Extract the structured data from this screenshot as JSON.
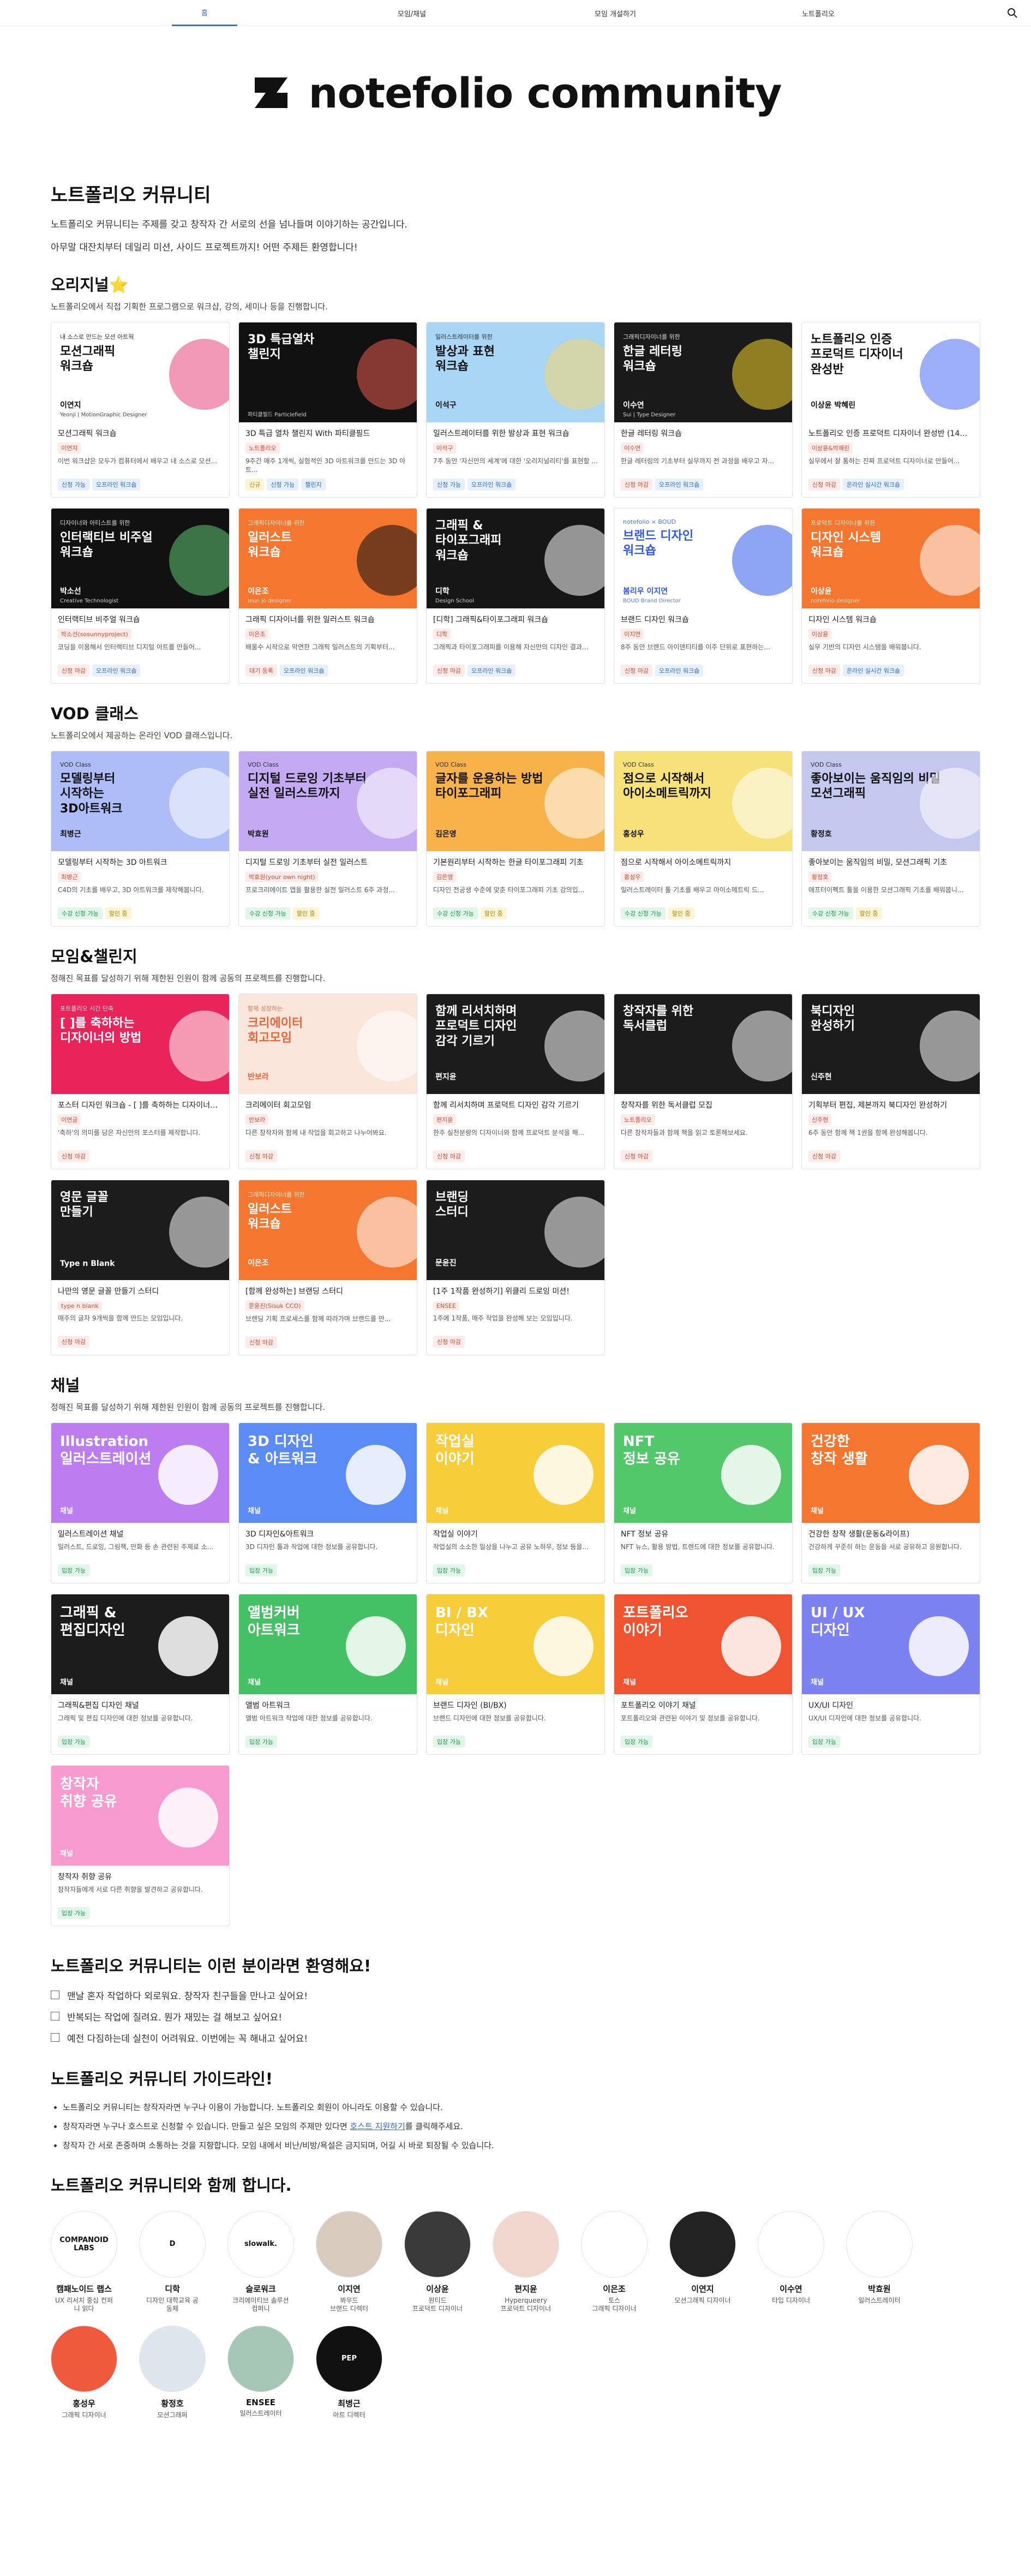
{
  "nav": {
    "tabs": [
      "홈",
      "모임/채널",
      "모임 개설하기",
      "노트폴리오"
    ],
    "active": 0
  },
  "hero": {
    "logo_text": "notefolio community"
  },
  "intro": {
    "title": "노트폴리오 커뮤니티",
    "line1": "노트폴리오 커뮤니티는 주제를 갖고 창작자 간 서로의 선을 넘나들며 이야기하는 공간입니다.",
    "line2": "아무말 대잔치부터 데일리 미션, 사이드 프로젝트까지! 어떤 주제든 환영합니다!"
  },
  "original": {
    "title": "오리지널⭐",
    "desc": "노트폴리오에서 직접 기획한 프로그램으로 워크샵, 강의, 세미나 등을 진행합니다.",
    "cards": [
      {
        "kicker": "내 소스로 만드는 모션 아트웍",
        "ttl": "모션그래픽\n워크숍",
        "auth": "이연지",
        "role": "Yeonji | MotionGraphic Designer",
        "title": "모션그래픽 워크숍",
        "tag": "이연지",
        "desc": "이번 워크샵은 모두가 컴퓨터에서 배우고 내 소스로 모션...",
        "chips": [
          [
            "신청 가능",
            "blue"
          ],
          [
            "오프라인 워크숍",
            "blue"
          ]
        ],
        "bg": "#ffffff",
        "fg": "#111",
        "accent": "#e8467c"
      },
      {
        "kicker": "",
        "ttl": "3D 특급열차\n챌린지",
        "auth": "",
        "role": "파티클필드 Particlefield",
        "title": "3D 특급 열차 챌린지 With 파티클필드",
        "tag": "노트폴리오",
        "desc": "9주간 매주 1개씩, 실험적인 3D 아트워크를 만드는 3D 아트...",
        "chips": [
          [
            "신규",
            "yellow"
          ],
          [
            "신청 가능",
            "blue"
          ],
          [
            "챌린지",
            "blue"
          ]
        ],
        "bg": "#111111",
        "fg": "#fff",
        "accent": "#e85a4f"
      },
      {
        "kicker": "일러스트레이터를 위한",
        "ttl": "발상과 표현\n워크숍",
        "auth": "이석구",
        "role": "",
        "title": "일러스트레이터를 위한 발상과 표현 워크숍",
        "tag": "이석구",
        "desc": "7주 동안 '자신만의 세계'에 대한 '오리지널리티'를 표현할 ...",
        "chips": [
          [
            "신청 가능",
            "blue"
          ],
          [
            "오프라인 워크숍",
            "blue"
          ]
        ],
        "bg": "#a9d6f5",
        "fg": "#111",
        "accent": "#f5d66b"
      },
      {
        "kicker": "그래픽디자이너를 위한",
        "ttl": "한글 레터링\n워크숍",
        "auth": "이수연",
        "role": "Sui | Type Designer",
        "title": "한글 레터링 워크숍",
        "tag": "이수연",
        "desc": "한글 레터링의 기초부터 실무까지 전 과정을 배우고 자...",
        "chips": [
          [
            "신청 마감",
            "red"
          ],
          [
            "오프라인 워크숍",
            "blue"
          ]
        ],
        "bg": "#1a1a1a",
        "fg": "#fff",
        "accent": "#f2d42a"
      },
      {
        "kicker": "",
        "ttl": "노트폴리오 인증\n프로덕트 디자이너\n완성반",
        "auth": "이상윤 박혜린",
        "role": "",
        "title": "노트폴리오 인증 프로덕트 디자이너 완성반 (14주코스)",
        "tag": "이상윤&박혜린",
        "desc": "실무에서 잘 통하는 진짜 프로덕트 디자이너로 만들어...",
        "chips": [
          [
            "신청 마감",
            "red"
          ],
          [
            "온라인 실시간 워크숍",
            "blue"
          ]
        ],
        "bg": "#ffffff",
        "fg": "#111",
        "accent": "#4b6cf0"
      },
      {
        "kicker": "디자이너와 아티스트를 위한",
        "ttl": "인터랙티브 비주얼\n워크숍",
        "auth": "박소선",
        "role": "Creative Technologist",
        "title": "인터랙티브 비주얼 워크숍",
        "tag": "박소선(sosunnyproject)",
        "desc": "코딩을 이용해서 인터랙티브 디지털 아트를 만들어...",
        "chips": [
          [
            "신청 마감",
            "red"
          ],
          [
            "오프라인 워크숍",
            "blue"
          ]
        ],
        "bg": "#111111",
        "fg": "#fff",
        "accent": "#5ec46f"
      },
      {
        "kicker": "그래픽디자이너를 위한",
        "ttl": "일러스트\n워크숍",
        "auth": "이은조",
        "role": "Ieun Jo designer",
        "title": "그래픽 디자이너를 위한 일러스트 워크숍",
        "tag": "이은조",
        "desc": "배울수 시작으로 막연한 그래픽 일러스트의 기획부터...",
        "chips": [
          [
            "대기 등록",
            "red"
          ],
          [
            "오프라인 워크숍",
            "blue"
          ]
        ],
        "bg": "#f4762f",
        "fg": "#fff",
        "accent": "#111"
      },
      {
        "kicker": "",
        "ttl": "그래픽 &\n타이포그래피\n워크숍",
        "auth": "디학",
        "role": "Design School",
        "title": "[디학] 그래픽&타이포그래피 워크숍",
        "tag": "디학",
        "desc": "그래픽과 타이포그래피를 이용해 자신만의 디자인 결과...",
        "chips": [
          [
            "신청 마감",
            "red"
          ],
          [
            "오프라인 워크숍",
            "blue"
          ]
        ],
        "bg": "#161616",
        "fg": "#fff",
        "accent": "#fff"
      },
      {
        "kicker": "notefolio × BOUD",
        "ttl": "브랜드 디자인\n워크숍",
        "auth": "봄리우 이지연",
        "role": "BOUD Brand Director",
        "title": "브랜드 디자인 워크숍",
        "tag": "이지연",
        "desc": "8주 동안 브랜드 아이덴티티를 이주 단위로 표현하는...",
        "chips": [
          [
            "신청 마감",
            "red"
          ],
          [
            "오프라인 워크숍",
            "blue"
          ]
        ],
        "bg": "#ffffff",
        "fg": "#2f5be8",
        "accent": "#2f5be8"
      },
      {
        "kicker": "프로덕트 디자이너를 위한",
        "ttl": "디자인 시스템\n워크숍",
        "auth": "이상윤",
        "role": "notefolio designer",
        "title": "디자인 시스템 워크숍",
        "tag": "이상윤",
        "desc": "실무 기반의 디자인 시스템을 배워봅니다.",
        "chips": [
          [
            "신청 마감",
            "red"
          ],
          [
            "온라인 실시간 워크숍",
            "blue"
          ]
        ],
        "bg": "#f4762f",
        "fg": "#fff",
        "accent": "#fff"
      }
    ]
  },
  "vod": {
    "title": "VOD 클래스",
    "desc": "노트폴리오에서 제공하는 온라인 VOD 클래스입니다.",
    "cards": [
      {
        "kicker": "VOD Class",
        "ttl": "모델링부터\n시작하는\n3D아트워크",
        "auth": "최병근",
        "title": "모델링부터 시작하는 3D 아트워크",
        "tag": "최병근",
        "desc": "C4D의 기초를 배우고, 3D 아트워크를 제작해봅니다.",
        "chips": [
          [
            "수강 신청 가능",
            "green"
          ],
          [
            "할인 중",
            "yellow"
          ]
        ],
        "bg": "#aebcf7",
        "fg": "#111"
      },
      {
        "kicker": "VOD Class",
        "ttl": "디지털 드로잉 기초부터\n실전 일러스트까지",
        "auth": "박효원",
        "title": "디지털 드로잉 기초부터 실전 일러스트",
        "tag": "박효원(your own night)",
        "desc": "프로크리에이트 앱을 활용한 실전 일러스트 6주 과정...",
        "chips": [
          [
            "수강 신청 가능",
            "green"
          ],
          [
            "할인 중",
            "yellow"
          ]
        ],
        "bg": "#c3aaf2",
        "fg": "#111"
      },
      {
        "kicker": "VOD Class",
        "ttl": "글자를 운용하는 방법\n타이포그래피",
        "auth": "김은영",
        "title": "기본원리부터 시작하는 한글 타이포그래피 기초",
        "tag": "김은영",
        "desc": "디자인 전공생 수준에 맞춘 타이포그래피 기초 강의입...",
        "chips": [
          [
            "수강 신청 가능",
            "green"
          ],
          [
            "할인 중",
            "yellow"
          ]
        ],
        "bg": "#f7b24a",
        "fg": "#111"
      },
      {
        "kicker": "VOD Class",
        "ttl": "점으로 시작해서\n아이소메트릭까지",
        "auth": "홍성우",
        "title": "점으로 시작해서 아이소메트릭까지",
        "tag": "홍성우",
        "desc": "일러스트레이터 툴 기초를 배우고 아이소메트릭 드...",
        "chips": [
          [
            "수강 신청 가능",
            "green"
          ],
          [
            "할인 중",
            "yellow"
          ]
        ],
        "bg": "#f7e27a",
        "fg": "#111"
      },
      {
        "kicker": "VOD Class",
        "ttl": "좋아보이는 움직임의 비밀\n모션그래픽",
        "auth": "황정호",
        "title": "좋아보이는 움직임의 비밀, 모션그래픽 기초",
        "tag": "황정호",
        "desc": "애프터이펙트 툴을 이용한 모션그래픽 기초를 배워봅니...",
        "chips": [
          [
            "수강 신청 가능",
            "green"
          ],
          [
            "할인 중",
            "yellow"
          ]
        ],
        "bg": "#c4c8ee",
        "fg": "#111"
      }
    ]
  },
  "moim": {
    "title": "모임&챌린지",
    "desc": "정해진 목표를 달성하기 위해 제한된 인원이 함께 공동의 프로젝트를 진행합니다.",
    "cards": [
      {
        "kicker": "포트폴리오 시간 단축",
        "ttl": "[ ]를 축하하는\n디자이너의 방법",
        "auth": "",
        "title": "포스터 디자인 워크숍 - [ ]를 축하하는 디자이너의 방법",
        "tag": "이연글",
        "desc": "'축하'의 의미를 담은 자신만의 포스터를 제작합니다.",
        "chips": [
          [
            "신청 마감",
            "red"
          ]
        ],
        "bg": "#e8245a",
        "fg": "#fff"
      },
      {
        "kicker": "함께 성장하는",
        "ttl": "크리에이터\n회고모임",
        "auth": "반보라",
        "title": "크리에이터 회고모임",
        "tag": "반보라",
        "desc": "다른 창작자와 함께 내 작업을 회고하고 나누어봐요.",
        "chips": [
          [
            "신청 마감",
            "red"
          ]
        ],
        "bg": "#fbe6dc",
        "fg": "#e8663a"
      },
      {
        "kicker": "",
        "ttl": "함께 리서치하며\n프로덕트 디자인\n감각 기르기",
        "auth": "편지윤",
        "title": "함께 리서치하며 프로덕트 디자인 감각 기르기",
        "tag": "편지윤",
        "desc": "한주 실천분량의 디자이너와 함께 프로덕트 분석을 해...",
        "chips": [
          [
            "신청 마감",
            "red"
          ]
        ],
        "bg": "#1c1c1c",
        "fg": "#fff"
      },
      {
        "kicker": "",
        "ttl": "창작자를 위한\n독서클럽",
        "auth": "",
        "title": "창작자를 위한 독서클럽 모집",
        "tag": "노트폴리오",
        "desc": "다른 창작자들과 함께 책을 읽고 토론해보세요.",
        "chips": [
          [
            "신청 마감",
            "red"
          ]
        ],
        "bg": "#1c1c1c",
        "fg": "#fff"
      },
      {
        "kicker": "",
        "ttl": "북디자인\n완성하기",
        "auth": "신주현",
        "title": "기획부터 편집, 제본까지 북디자인 완성하기",
        "tag": "신주현",
        "desc": "6주 동안 함께 책 1권을 함께 완성해봅니다.",
        "chips": [
          [
            "신청 마감",
            "red"
          ]
        ],
        "bg": "#1c1c1c",
        "fg": "#fff"
      },
      {
        "kicker": "",
        "ttl": "영문 글꼴\n만들기",
        "auth": "Type n Blank",
        "title": "나만의 영문 글꼴 만들기 스터디",
        "tag": "type n blank",
        "desc": "매주의 글자 9개씩을 함께 만드는 모임입니다.",
        "chips": [
          [
            "신청 마감",
            "red"
          ]
        ],
        "bg": "#1c1c1c",
        "fg": "#fff"
      },
      {
        "kicker": "그래픽디자이너를 위한",
        "ttl": "일러스트\n워크숍",
        "auth": "이은조",
        "title": "[함께 완성하는] 브랜딩 스터디",
        "tag": "문윤진(Sisuk CCO)",
        "desc": "브랜딩 기획 프로세스를 함께 따라가며 브랜드를 만...",
        "chips": [
          [
            "신청 마감",
            "red"
          ]
        ],
        "bg": "#f4762f",
        "fg": "#fff"
      },
      {
        "kicker": "",
        "ttl": "브랜딩\n스터디",
        "auth": "문윤진",
        "title": "[1주 1작품 완성하기] 위클리 드로잉 미션!",
        "tag": "ENSEE",
        "desc": "1주에 1작품, 매주 작업을 완성해 보는 모임입니다.",
        "chips": [
          [
            "신청 마감",
            "red"
          ]
        ],
        "bg": "#1c1c1c",
        "fg": "#fff"
      }
    ]
  },
  "channel": {
    "title": "채널",
    "desc": "정해진 목표를 달성하기 위해 제한된 인원이 함께 공동의 프로젝트를 진행합니다.",
    "cards": [
      {
        "ttl": "Illustration\n일러스트레이션",
        "title": "일러스트레이션 채널",
        "desc": "일러스트, 드로잉, 그림책, 만화 등 손 관련된 주제로 소...",
        "bg": "#bb7df0"
      },
      {
        "ttl": "3D 디자인\n& 아트워크",
        "title": "3D 디자인&아트워크",
        "desc": "3D 디자인 툴과 작업에 대한 정보를 공유합니다.",
        "bg": "#5b8bf5"
      },
      {
        "ttl": "작업실\n이야기",
        "title": "작업실 이야기",
        "desc": "작업실의 소소한 일상을 나누고 공유 노하우, 정보 등을...",
        "bg": "#f7cd3a"
      },
      {
        "ttl": "NFT\n정보 공유",
        "title": "NFT 정보 공유",
        "desc": "NFT 뉴스, 활용 방법, 트렌드에 대한 정보를 공유합니다.",
        "bg": "#52c86a"
      },
      {
        "ttl": "건강한\n창작 생활",
        "title": "건강한 창작 생활(운동&라이프)",
        "desc": "건강하게 꾸준히 하는 운동을 서로 공유하고 응원합니다.",
        "bg": "#f4762f"
      },
      {
        "ttl": "그래픽 &\n편집디자인",
        "title": "그래픽&편집 디자인 채널",
        "desc": "그래픽 및 편집 디자인에 대한 정보를 공유합니다.",
        "bg": "#1c1c1c"
      },
      {
        "ttl": "앨범커버\n아트워크",
        "title": "앨범 아트워크",
        "desc": "앨범 아트워크 작업에 대한 정보를 공유합니다.",
        "bg": "#44c165"
      },
      {
        "ttl": "BI / BX\n디자인",
        "title": "브랜드 디자인 (BI/BX)",
        "desc": "브랜드 디자인에 대한 정보를 공유합니다.",
        "bg": "#f7cd3a"
      },
      {
        "ttl": "포트폴리오\n이야기",
        "title": "포트폴리오 이야기 채널",
        "desc": "포트폴리오와 관련된 이야기 및 정보를 공유합니다.",
        "bg": "#f0532f"
      },
      {
        "ttl": "UI / UX\n디자인",
        "title": "UX/UI 디자인",
        "desc": "UX/UI 디자인에 대한 정보를 공유합니다.",
        "bg": "#7d82f2"
      },
      {
        "ttl": "창작자\n취향 공유",
        "title": "창작자 취향 공유",
        "desc": "창작자들에게 서로 다른 취향을 발견하고 공유합니다.",
        "bg": "#f79ad0"
      }
    ],
    "label": "채널",
    "chip": "입장 가능"
  },
  "welcome": {
    "title": "노트폴리오 커뮤니티는 이런 분이라면 환영해요!",
    "items": [
      "맨날 혼자 작업하다 외로워요. 창작자 친구들을 만나고 싶어요!",
      "반복되는 작업에 질려요. 뭔가 재밌는 걸 해보고 싶어요!",
      "예전 다짐하는데 실천이 어려워요. 이번에는 꼭 해내고 싶어요!"
    ]
  },
  "guide": {
    "title": "노트폴리오 커뮤니티 가이드라인!",
    "items": [
      "노트폴리오 커뮤니티는 창작자라면 누구나 이용이 가능합니다. 노트폴리오 회원이 아니라도 이용할 수 있습니다.",
      "창작자라면 누구나 호스트로 신청할 수 있습니다. 만들고 싶은 모임의 주제만 있다면",
      "창작자 간 서로 존중하며 소통하는 것을 지향합니다. 모임 내에서 비난/비방/욕설은 금지되며, 어길 시 바로 퇴장될 수 있습니다."
    ],
    "link": "호스트 지원하기",
    "link_after": "를 클릭해주세요."
  },
  "partners": {
    "title": "노트폴리오 커뮤니티와 함께 합니다.",
    "items": [
      {
        "name": "캠패노이드 랩스",
        "desc": "UX 리서치 중심 컨퍼\n니 읽다",
        "mark": "COMPANOID\nLABS",
        "bg": "#fff",
        "fg": "#111"
      },
      {
        "name": "디학",
        "desc": "디자인 대학교육 공\n동체",
        "mark": "D",
        "bg": "#fff",
        "fg": "#111"
      },
      {
        "name": "슬로워크",
        "desc": "크리에이티브 솔루션\n컴퍼니",
        "mark": "slowalk.",
        "bg": "#fff",
        "fg": "#111"
      },
      {
        "name": "이지연",
        "desc": "봐우드\n브랜드 디렉터",
        "mark": "",
        "bg": "#d9cbbd",
        "fg": "#111"
      },
      {
        "name": "이상윤",
        "desc": "원티드\n프로덕트 디자이너",
        "mark": "",
        "bg": "#3a3a3a",
        "fg": "#fff"
      },
      {
        "name": "편지윤",
        "desc": "Hyperqueery\n프로덕트 디자이너",
        "mark": "",
        "bg": "#f0d6cc",
        "fg": "#111"
      },
      {
        "name": "이은조",
        "desc": "토스\n그래픽 디자이너",
        "mark": "",
        "bg": "#fff",
        "fg": "#111"
      },
      {
        "name": "이연지",
        "desc": "모션그래픽 디자이너",
        "mark": "",
        "bg": "#222",
        "fg": "#fff"
      },
      {
        "name": "이수연",
        "desc": "타입 디자이너",
        "mark": "",
        "bg": "#fff",
        "fg": "#111"
      },
      {
        "name": "박효원",
        "desc": "일러스트레이터",
        "mark": "",
        "bg": "#fff",
        "fg": "#111"
      },
      {
        "name": "홍성우",
        "desc": "그래픽 디자이너",
        "mark": "",
        "bg": "#ef5a3c",
        "fg": "#fff"
      },
      {
        "name": "황정호",
        "desc": "모션그래퍼",
        "mark": "",
        "bg": "#dfe6ee",
        "fg": "#111"
      },
      {
        "name": "ENSEE",
        "desc": "일러스트레이터",
        "mark": "",
        "bg": "#a6c7b5",
        "fg": "#111"
      },
      {
        "name": "최병근",
        "desc": "아트 디렉터",
        "mark": "PEP",
        "bg": "#111",
        "fg": "#fff"
      }
    ]
  }
}
